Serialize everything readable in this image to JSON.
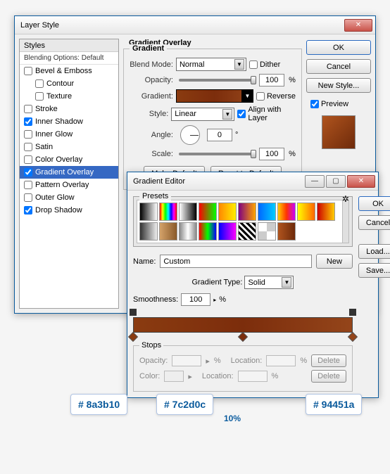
{
  "layerStyle": {
    "title": "Layer Style",
    "stylesHeader": "Styles",
    "blendingDefault": "Blending Options: Default",
    "items": [
      {
        "label": "Bevel & Emboss",
        "checked": false,
        "indent": false
      },
      {
        "label": "Contour",
        "checked": false,
        "indent": true
      },
      {
        "label": "Texture",
        "checked": false,
        "indent": true
      },
      {
        "label": "Stroke",
        "checked": false,
        "indent": false
      },
      {
        "label": "Inner Shadow",
        "checked": true,
        "indent": false
      },
      {
        "label": "Inner Glow",
        "checked": false,
        "indent": false
      },
      {
        "label": "Satin",
        "checked": false,
        "indent": false
      },
      {
        "label": "Color Overlay",
        "checked": false,
        "indent": false
      },
      {
        "label": "Gradient Overlay",
        "checked": true,
        "indent": false,
        "selected": true
      },
      {
        "label": "Pattern Overlay",
        "checked": false,
        "indent": false
      },
      {
        "label": "Outer Glow",
        "checked": false,
        "indent": false
      },
      {
        "label": "Drop Shadow",
        "checked": true,
        "indent": false
      }
    ],
    "section": {
      "title": "Gradient Overlay",
      "sub": "Gradient",
      "blendModeLabel": "Blend Mode:",
      "blendMode": "Normal",
      "dither": "Dither",
      "opacityLabel": "Opacity:",
      "opacity": "100",
      "gradientLabel": "Gradient:",
      "reverse": "Reverse",
      "styleLabel": "Style:",
      "style": "Linear",
      "align": "Align with Layer",
      "angleLabel": "Angle:",
      "angle": "0",
      "deg": "°",
      "scaleLabel": "Scale:",
      "scale": "100",
      "pct": "%",
      "makeDefault": "Make Default",
      "resetDefault": "Reset to Default"
    },
    "buttons": {
      "ok": "OK",
      "cancel": "Cancel",
      "newStyle": "New Style...",
      "preview": "Preview"
    }
  },
  "gradientEditor": {
    "title": "Gradient Editor",
    "presets": "Presets",
    "ok": "OK",
    "cancel": "Cancel",
    "load": "Load...",
    "save": "Save...",
    "nameLabel": "Name:",
    "name": "Custom",
    "new": "New",
    "gtypeLabel": "Gradient Type:",
    "gtype": "Solid",
    "smoothLabel": "Smoothness:",
    "smooth": "100",
    "pct": "%",
    "stopsTitle": "Stops",
    "opacityLabel": "Opacity:",
    "locationLabel": "Location:",
    "colorLabel": "Color:",
    "delete": "Delete",
    "presetGradients": [
      "linear-gradient(90deg,#000,#fff)",
      "linear-gradient(90deg,#f00,#ff0,#0f0,#0ff,#00f,#f0f,#f00)",
      "linear-gradient(90deg,#fff,#000)",
      "linear-gradient(90deg,#f00,#0f0)",
      "linear-gradient(90deg,#ff8800,#ffee00)",
      "linear-gradient(90deg,#800080,#ffa500)",
      "linear-gradient(90deg,#0066ff,#00ccff)",
      "linear-gradient(90deg,#ffcc00,#ff3300,#cc00ff)",
      "linear-gradient(90deg,#ffff00,#ff6600)",
      "linear-gradient(90deg,#cc0000,#ffcc00)",
      "linear-gradient(90deg,#333,#eee)",
      "linear-gradient(90deg,#d4a26a,#8a5a2a)",
      "linear-gradient(90deg,#888,#fff,#888)",
      "linear-gradient(90deg,#ff0000,#00ff00,#0000ff)",
      "linear-gradient(90deg,#00f,#f0f)",
      "repeating-linear-gradient(45deg,#000 0 3px,#fff 3px 6px)",
      "repeating-conic-gradient(#ccc 0 25%,#fff 0 50%)",
      "linear-gradient(90deg,#b0541e,#6e2a0a)"
    ]
  },
  "annotations": {
    "c1": "# 8a3b10",
    "c2": "# 7c2d0c",
    "c3": "# 94451a",
    "mid": "10%"
  },
  "colors": {
    "stop1": "#8a3b10",
    "stop2": "#7c2d0c",
    "stop3": "#94451a"
  }
}
